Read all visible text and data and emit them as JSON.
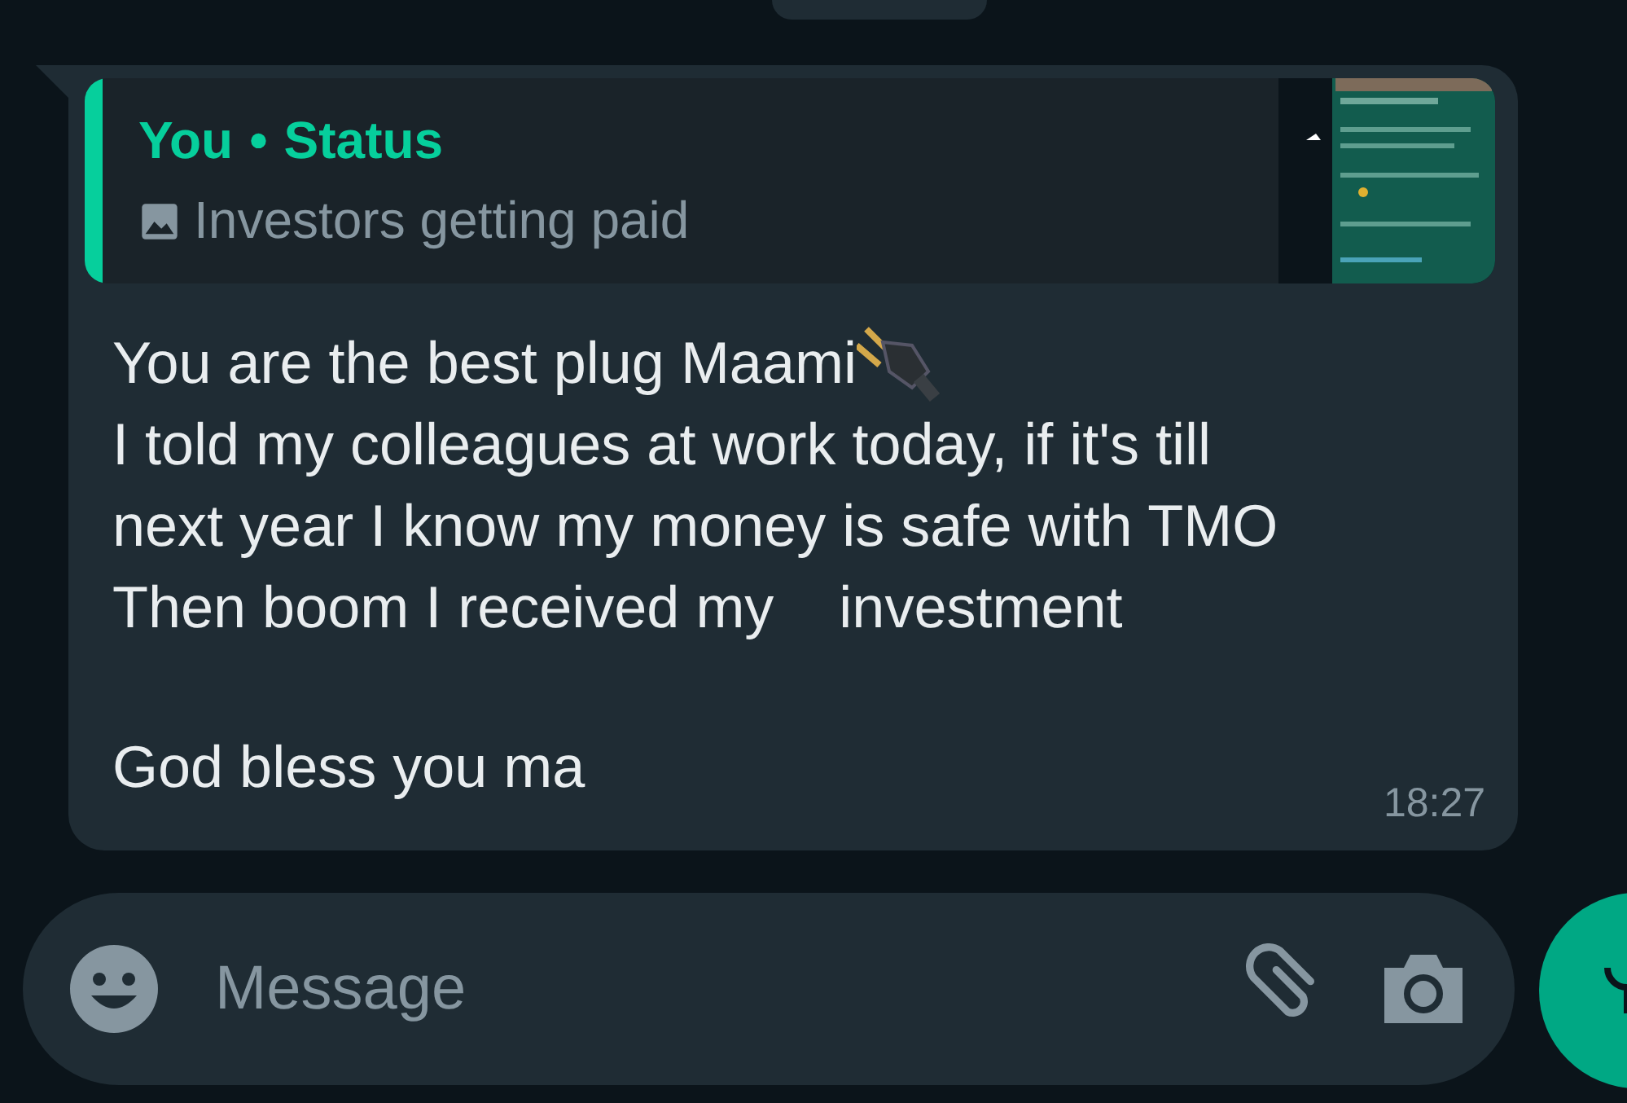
{
  "quote": {
    "author": "You",
    "separator": "•",
    "source": "Status",
    "caption": "Investors getting paid"
  },
  "message": {
    "paragraphs": [
      [
        "You are the best plug Maami",
        "I told my colleagues at work today, if it's till",
        "next year I know my money is safe with TMO",
        "Then boom I received my    investment"
      ],
      [
        "God bless you ma"
      ]
    ],
    "time": "18:27"
  },
  "composer": {
    "placeholder": "Message"
  }
}
